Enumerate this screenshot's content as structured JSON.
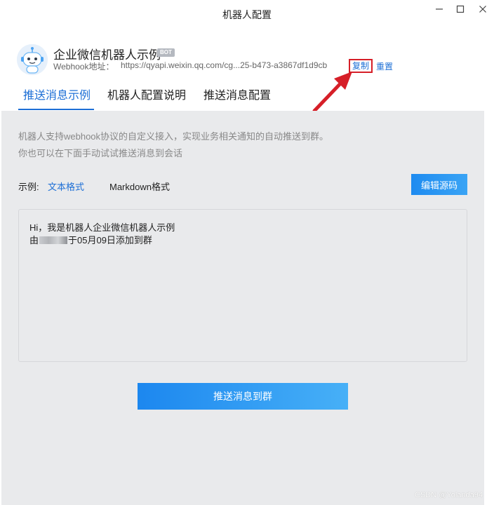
{
  "window": {
    "title": "机器人配置",
    "icons": [
      "minimize-icon",
      "maximize-icon",
      "close-icon"
    ]
  },
  "bot": {
    "name": "企业微信机器人示例",
    "badge": "BOT",
    "webhook_label": "Webhook地址：",
    "webhook_url": "https://qyapi.weixin.qq.com/cg...25-b473-a3867df1d9cb",
    "copy_label": "复制",
    "reset_label": "重置"
  },
  "tabs": [
    {
      "label": "推送消息示例",
      "active": true
    },
    {
      "label": "机器人配置说明",
      "active": false
    },
    {
      "label": "推送消息配置",
      "active": false
    }
  ],
  "panel": {
    "desc_line1": "机器人支持webhook协议的自定义接入，实现业务相关通知的自动推送到群。",
    "desc_line2": "你也可以在下面手动试试推送消息到会话",
    "example_label": "示例:",
    "format_text": "文本格式",
    "format_markdown": "Markdown格式",
    "edit_source_label": "编辑源码",
    "message_line1": "Hi，我是机器人企业微信机器人示例",
    "message_line2_prefix": "由",
    "message_line2_suffix": "于05月09日添加到群",
    "send_label": "推送消息到群"
  },
  "watermark": "CSDN @Yolanda94",
  "colors": {
    "accent": "#1d6fd6",
    "button": "#1e8bf0",
    "highlight_box": "#d61f28",
    "panel_bg": "#e9eaec"
  }
}
